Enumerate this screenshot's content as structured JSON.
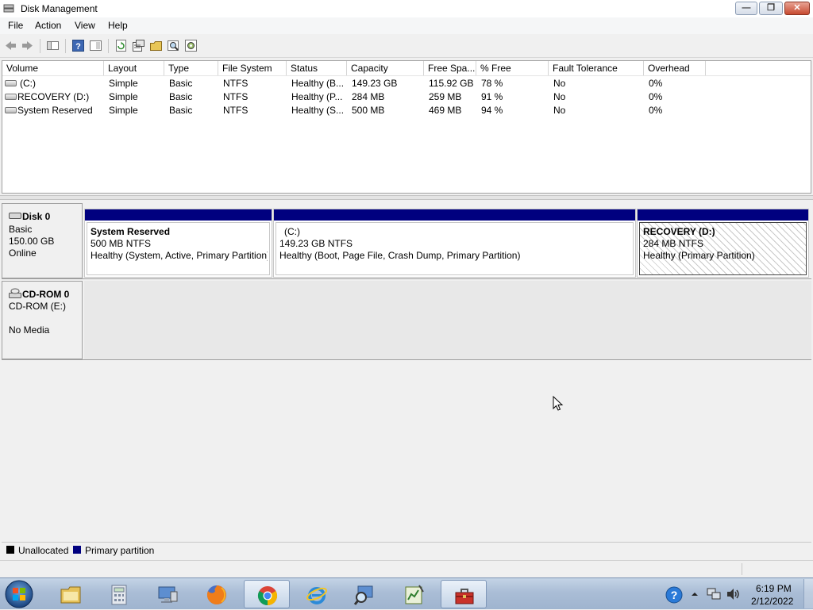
{
  "window": {
    "title": "Disk Management",
    "buttons": {
      "minimize": "—",
      "restore": "❐",
      "close": "✕"
    }
  },
  "menu": {
    "items": [
      "File",
      "Action",
      "View",
      "Help"
    ]
  },
  "toolbar": {
    "icons": [
      "back-icon",
      "forward-icon",
      "show-hide-tree-icon",
      "help-icon",
      "properties-pane-icon",
      "refresh-icon",
      "properties-icon",
      "open-icon",
      "find-icon",
      "settings-icon"
    ]
  },
  "volume_list": {
    "columns": [
      "Volume",
      "Layout",
      "Type",
      "File System",
      "Status",
      "Capacity",
      "Free Spa...",
      "% Free",
      "Fault Tolerance",
      "Overhead"
    ],
    "rows": [
      [
        "(C:)",
        "Simple",
        "Basic",
        "NTFS",
        "Healthy (B...",
        "149.23 GB",
        "115.92 GB",
        "78 %",
        "No",
        "0%"
      ],
      [
        "RECOVERY (D:)",
        "Simple",
        "Basic",
        "NTFS",
        "Healthy (P...",
        "284 MB",
        "259 MB",
        "91 %",
        "No",
        "0%"
      ],
      [
        "System Reserved",
        "Simple",
        "Basic",
        "NTFS",
        "Healthy (S...",
        "500 MB",
        "469 MB",
        "94 %",
        "No",
        "0%"
      ]
    ]
  },
  "disks": [
    {
      "name": "Disk 0",
      "type": "Basic",
      "size": "150.00 GB",
      "state": "Online",
      "partitions": [
        {
          "name": "System Reserved",
          "size": "500 MB NTFS",
          "status": "Healthy (System, Active, Primary Partition)"
        },
        {
          "name": "(C:)",
          "size": "149.23 GB NTFS",
          "status": "Healthy (Boot, Page File, Crash Dump, Primary Partition)"
        },
        {
          "name": "RECOVERY  (D:)",
          "size": "284 MB NTFS",
          "status": "Healthy (Primary Partition)"
        }
      ]
    },
    {
      "name": "CD-ROM 0",
      "type": "CD-ROM (E:)",
      "state": "No Media"
    }
  ],
  "legend": [
    {
      "label": "Unallocated",
      "color": "#000000"
    },
    {
      "label": "Primary partition",
      "color": "#00007f"
    }
  ],
  "taskbar": {
    "apps": [
      "windows-explorer",
      "calculator",
      "remote-desktop",
      "firefox",
      "chrome",
      "internet-explorer",
      "search-tool",
      "chart-editor",
      "toolbox"
    ],
    "tray_icons": [
      "help-icon",
      "show-hidden-icons-arrow",
      "network-icon",
      "volume-icon"
    ],
    "time": "6:19 PM",
    "date": "2/12/2022"
  },
  "colors": {
    "primary_partition": "#00007f",
    "titlebar": "#ffffff",
    "taskbar": "#aabdd6"
  }
}
